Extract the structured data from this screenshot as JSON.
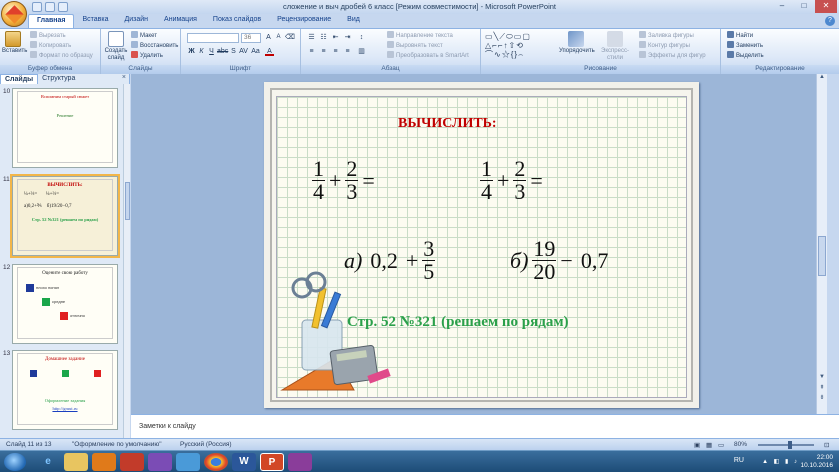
{
  "window": {
    "title": "сложение и выч дробей 6 класс [Режим совместимости] - Microsoft PowerPoint",
    "minimize": "–",
    "maximize": "□",
    "close": "✕"
  },
  "ribbon_tabs": [
    "Главная",
    "Вставка",
    "Дизайн",
    "Анимация",
    "Показ слайдов",
    "Рецензирование",
    "Вид"
  ],
  "help_label": "?",
  "ribbon": {
    "clipboard": {
      "label": "Буфер обмена",
      "paste": "Вставить",
      "cut": "Вырезать",
      "copy": "Копировать",
      "format_painter": "Формат по образцу"
    },
    "slides": {
      "label": "Слайды",
      "new_slide": "Создать слайд",
      "layout": "Макет",
      "reset": "Восстановить",
      "delete": "Удалить"
    },
    "font": {
      "label": "Шрифт",
      "font_size": "36"
    },
    "paragraph": {
      "label": "Абзац",
      "text_direction": "Направление текста",
      "align_text": "Выровнять текст",
      "smartart": "Преобразовать в SmartArt"
    },
    "drawing": {
      "label": "Рисование",
      "arrange": "Упорядочить",
      "quick_styles": "Экспресс-стили",
      "shape_fill": "Заливка фигуры",
      "shape_outline": "Контур фигуры",
      "shape_effects": "Эффекты для фигур"
    },
    "editing": {
      "label": "Редактирование",
      "find": "Найти",
      "replace": "Заменить",
      "select": "Выделить"
    }
  },
  "left_panel": {
    "tabs": [
      "Слайды",
      "Структура"
    ],
    "close": "×",
    "thumbnails": [
      {
        "number": "10",
        "title": "Вспомним старый сюжет",
        "line1": "Решение"
      },
      {
        "number": "11",
        "title": "ВЫЧИСЛИТЬ:",
        "line1": "Стр. 52 №321 (решаем по рядам)"
      },
      {
        "number": "12",
        "title": "Оцените свою работу",
        "items": [
          "плохо понял",
          "средне",
          "отлично"
        ]
      },
      {
        "number": "13",
        "title": "Домашнее задание",
        "line1": "Оформление задания",
        "link": "http://gruut.ru"
      }
    ]
  },
  "slide": {
    "title": "ВЫЧИСЛИТЬ:",
    "expr1": {
      "n1": "1",
      "d1": "4",
      "op": "+",
      "n2": "2",
      "d2": "3",
      "eq": "="
    },
    "expr2": {
      "n1": "1",
      "d1": "4",
      "op": "+",
      "n2": "2",
      "d2": "3",
      "eq": "="
    },
    "task_a": {
      "label": "а)",
      "value": "0,2",
      "op": "+",
      "n": "3",
      "d": "5"
    },
    "task_b": {
      "label": "б)",
      "n": "19",
      "d": "20",
      "op": "−",
      "value": "0,7"
    },
    "task_text": "Стр. 52 №321 (решаем по рядам)"
  },
  "notes_placeholder": "Заметки к слайду",
  "status": {
    "slide_info": "Слайд 11 из 13",
    "theme": "\"Оформление по умолчанию\"",
    "language": "Русский (Россия)",
    "zoom": "80%"
  },
  "taskbar": {
    "lang": "RU",
    "time": "22:00",
    "date": "10.10.2016"
  },
  "colors": {
    "title_red": "#c00000",
    "task_green": "#2aa04a",
    "ribbon_blue": "#15428b"
  }
}
